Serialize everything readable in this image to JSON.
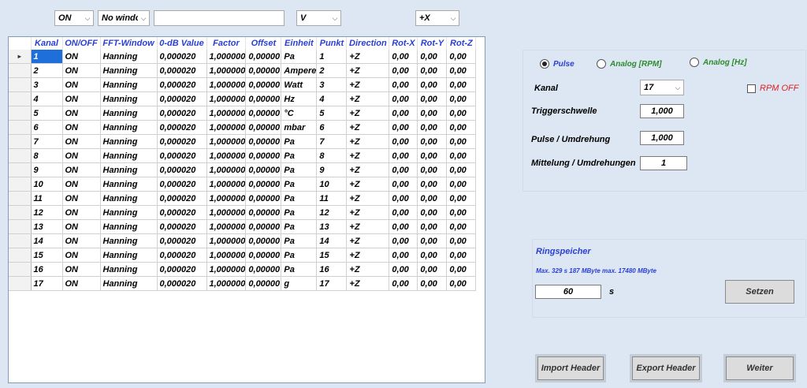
{
  "toolbar": {
    "onoff_value": "ON",
    "window_value": "No windo",
    "text_value": "",
    "unit_value": "V",
    "direction_value": "+X"
  },
  "grid": {
    "headers": [
      "Kanal",
      "ON/OFF",
      "FFT-Window",
      "0-dB Value",
      "Factor",
      "Offset",
      "Einheit",
      "Punkt",
      "Direction",
      "Rot-X",
      "Rot-Y",
      "Rot-Z"
    ],
    "rows": [
      [
        "1",
        "ON",
        "Hanning",
        "0,000020",
        "1,000000",
        "0,00000",
        "Pa",
        "1",
        "+Z",
        "0,00",
        "0,00",
        "0,00"
      ],
      [
        "2",
        "ON",
        "Hanning",
        "0,000020",
        "1,000000",
        "0,00000",
        "Ampere",
        "2",
        "+Z",
        "0,00",
        "0,00",
        "0,00"
      ],
      [
        "3",
        "ON",
        "Hanning",
        "0,000020",
        "1,000000",
        "0,00000",
        "Watt",
        "3",
        "+Z",
        "0,00",
        "0,00",
        "0,00"
      ],
      [
        "4",
        "ON",
        "Hanning",
        "0,000020",
        "1,000000",
        "0,00000",
        "Hz",
        "4",
        "+Z",
        "0,00",
        "0,00",
        "0,00"
      ],
      [
        "5",
        "ON",
        "Hanning",
        "0,000020",
        "1,000000",
        "0,00000",
        "°C",
        "5",
        "+Z",
        "0,00",
        "0,00",
        "0,00"
      ],
      [
        "6",
        "ON",
        "Hanning",
        "0,000020",
        "1,000000",
        "0,00000",
        "mbar",
        "6",
        "+Z",
        "0,00",
        "0,00",
        "0,00"
      ],
      [
        "7",
        "ON",
        "Hanning",
        "0,000020",
        "1,000000",
        "0,00000",
        "Pa",
        "7",
        "+Z",
        "0,00",
        "0,00",
        "0,00"
      ],
      [
        "8",
        "ON",
        "Hanning",
        "0,000020",
        "1,000000",
        "0,00000",
        "Pa",
        "8",
        "+Z",
        "0,00",
        "0,00",
        "0,00"
      ],
      [
        "9",
        "ON",
        "Hanning",
        "0,000020",
        "1,000000",
        "0,00000",
        "Pa",
        "9",
        "+Z",
        "0,00",
        "0,00",
        "0,00"
      ],
      [
        "10",
        "ON",
        "Hanning",
        "0,000020",
        "1,000000",
        "0,00000",
        "Pa",
        "10",
        "+Z",
        "0,00",
        "0,00",
        "0,00"
      ],
      [
        "11",
        "ON",
        "Hanning",
        "0,000020",
        "1,000000",
        "0,00000",
        "Pa",
        "11",
        "+Z",
        "0,00",
        "0,00",
        "0,00"
      ],
      [
        "12",
        "ON",
        "Hanning",
        "0,000020",
        "1,000000",
        "0,00000",
        "Pa",
        "12",
        "+Z",
        "0,00",
        "0,00",
        "0,00"
      ],
      [
        "13",
        "ON",
        "Hanning",
        "0,000020",
        "1,000000",
        "0,00000",
        "Pa",
        "13",
        "+Z",
        "0,00",
        "0,00",
        "0,00"
      ],
      [
        "14",
        "ON",
        "Hanning",
        "0,000020",
        "1,000000",
        "0,00000",
        "Pa",
        "14",
        "+Z",
        "0,00",
        "0,00",
        "0,00"
      ],
      [
        "15",
        "ON",
        "Hanning",
        "0,000020",
        "1,000000",
        "0,00000",
        "Pa",
        "15",
        "+Z",
        "0,00",
        "0,00",
        "0,00"
      ],
      [
        "16",
        "ON",
        "Hanning",
        "0,000020",
        "1,000000",
        "0,00000",
        "Pa",
        "16",
        "+Z",
        "0,00",
        "0,00",
        "0,00"
      ],
      [
        "17",
        "ON",
        "Hanning",
        "0,000020",
        "1,000000",
        "0,00000",
        "g",
        "17",
        "+Z",
        "0,00",
        "0,00",
        "0,00"
      ]
    ],
    "current_row_marker": "▸"
  },
  "trigger": {
    "radio_pulse": "Pulse",
    "radio_analog_rpm": "Analog [RPM]",
    "radio_analog_hz": "Analog [Hz]",
    "selected_mode": "Pulse",
    "kanal_label": "Kanal",
    "kanal_value": "17",
    "rpm_off_label": "RPM OFF",
    "trigger_label": "Triggerschwelle",
    "trigger_value": "1,000",
    "pulse_label": "Pulse / Umdrehung",
    "pulse_value": "1,000",
    "mittelung_label": "Mittelung / Umdrehungen",
    "mittelung_value": "1"
  },
  "ring": {
    "title": "Ringspeicher",
    "info": "Max. 329 s  187 MByte  max. 17480 MByte",
    "value": "60",
    "unit": "s",
    "set_button": "Setzen"
  },
  "buttons": {
    "import": "Import Header",
    "export": "Export Header",
    "weiter": "Weiter"
  },
  "colors": {
    "background": "#dce7f3",
    "header_text": "#2a3fd2",
    "selection": "#1e6fd9",
    "green_label": "#2e8b2e",
    "red_label": "#e02020",
    "ring_title": "#2a3fd2"
  }
}
